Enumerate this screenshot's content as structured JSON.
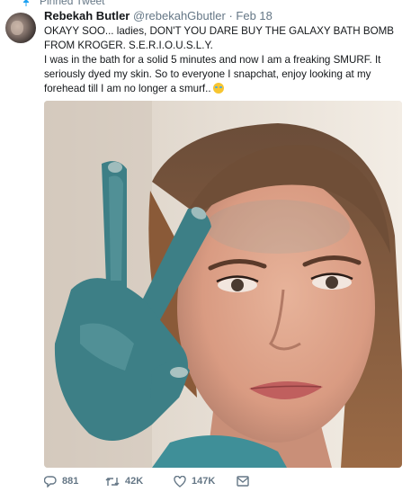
{
  "pinned_label": "Pinned Tweet",
  "accent_color": "#1da1f2",
  "tweet": {
    "author_name": "Rebekah Butler",
    "handle": "@rebekahGbutler",
    "separator": "·",
    "date": "Feb 18",
    "line1": "OKAYY SOO... ladies, DON'T YOU DARE BUY THE GALAXY BATH BOMB FROM KROGER. S.E.R.I.O.U.S.L.Y.",
    "line2": "I was in the bath for a solid 5 minutes and now I am a freaking SMURF. It seriously dyed my skin. So to everyone I snapchat, enjoy looking at my forehead till I am no longer a smurf..",
    "emoji": "face-with-tears-of-joy-emoji"
  },
  "actions": {
    "reply_count": "881",
    "retweet_count": "42K",
    "like_count": "147K",
    "icons": [
      "reply-icon",
      "retweet-icon",
      "like-icon",
      "message-icon"
    ]
  }
}
